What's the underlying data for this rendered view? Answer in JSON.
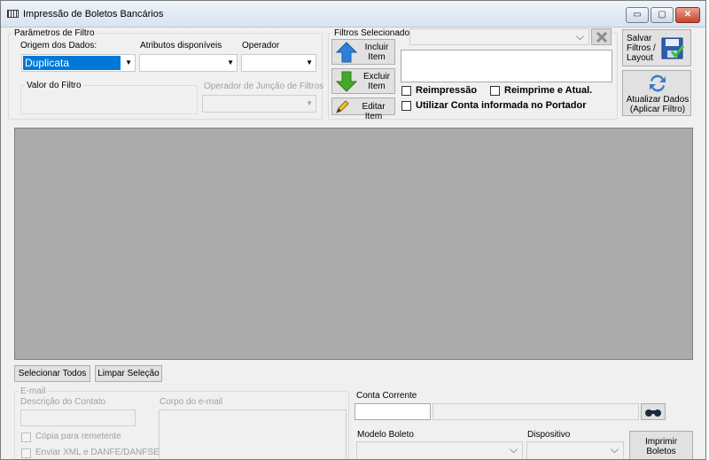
{
  "window": {
    "title": "Impressão de Boletos Bancários",
    "controls": {
      "minimize": "▭",
      "maximize": "▢",
      "close": "✕"
    }
  },
  "filter_params": {
    "group_label": "Parâmetros de Filtro",
    "origin_label": "Origem dos Dados:",
    "origin_value": "Duplicata",
    "attributes_label": "Atributos disponíveis",
    "attributes_value": "",
    "operator_label": "Operador",
    "operator_value": "",
    "filter_value_label": "Valor do Filtro",
    "join_operator_label": "Operador de Junção de Filtros"
  },
  "selected_filters": {
    "label": "Filtros Selecionados",
    "include_button": "Incluir\nItem",
    "exclude_button": "Excluir\nItem",
    "edit_button": "Editar Item"
  },
  "checkboxes": {
    "reprint": "Reimpressão",
    "reprint_update": "Reimprime e Atual.",
    "use_account": "Utilizar Conta informada no Portador"
  },
  "actions": {
    "save_filters": "Salvar\nFiltros /\nLayout",
    "update_data": "Atualizar Dados\n(Aplicar Filtro)"
  },
  "grid_buttons": {
    "select_all": "Selecionar Todos",
    "clear_selection": "Limpar Seleção"
  },
  "email": {
    "group_label": "E-mail",
    "contact_description_label": "Descrição do Contato",
    "body_label": "Corpo do e-mail",
    "copy_sender": "Cópia para remetente",
    "send_xml": "Enviar XML e DANFE/DANFSE"
  },
  "account": {
    "label": "Conta Corrente",
    "model_label": "Modelo Boleto",
    "device_label": "Dispositivo",
    "print_button": "Imprimir\nBoletos"
  },
  "icons": {
    "window": "app-grid-icon",
    "include": "blue-up-arrow-icon",
    "exclude": "green-down-arrow-icon",
    "edit": "pencil-icon",
    "save": "floppy-disk-icon",
    "refresh": "refresh-arrows-icon",
    "clear": "clear-x-icon",
    "lookup": "binoculars-icon"
  },
  "colors": {
    "selection": "#0078d7",
    "grid_bg": "#ababab",
    "include_arrow": "#2f7fd8",
    "exclude_arrow": "#46a829"
  }
}
